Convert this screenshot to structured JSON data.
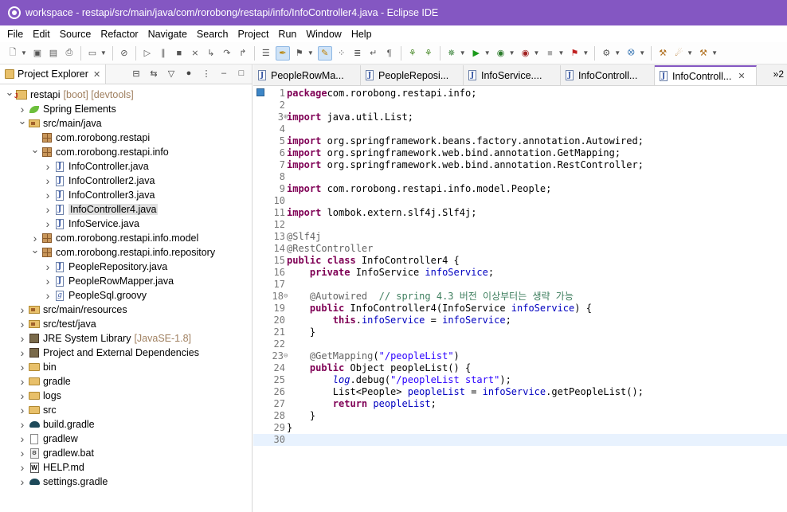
{
  "window": {
    "title": "workspace - restapi/src/main/java/com/rorobong/restapi/info/InfoController4.java - Eclipse IDE"
  },
  "menu": [
    "File",
    "Edit",
    "Source",
    "Refactor",
    "Navigate",
    "Search",
    "Project",
    "Run",
    "Window",
    "Help"
  ],
  "explorer": {
    "tab_label": "Project Explorer",
    "close": "✕",
    "tree": [
      {
        "label": "restapi",
        "extra": "[boot] [devtools]",
        "depth": 0,
        "arrow": "open",
        "icon": "project-icon"
      },
      {
        "label": "Spring Elements",
        "extra": "",
        "depth": 1,
        "arrow": "closed",
        "icon": "spring-leaf-icon"
      },
      {
        "label": "src/main/java",
        "extra": "",
        "depth": 1,
        "arrow": "open",
        "icon": "source-folder-icon"
      },
      {
        "label": "com.rorobong.restapi",
        "extra": "",
        "depth": 2,
        "arrow": "none",
        "icon": "package-icon"
      },
      {
        "label": "com.rorobong.restapi.info",
        "extra": "",
        "depth": 2,
        "arrow": "open",
        "icon": "package-icon"
      },
      {
        "label": "InfoController.java",
        "extra": "",
        "depth": 3,
        "arrow": "closed",
        "icon": "java-file-icon"
      },
      {
        "label": "InfoController2.java",
        "extra": "",
        "depth": 3,
        "arrow": "closed",
        "icon": "java-file-icon"
      },
      {
        "label": "InfoController3.java",
        "extra": "",
        "depth": 3,
        "arrow": "closed",
        "icon": "java-file-icon"
      },
      {
        "label": "InfoController4.java",
        "extra": "",
        "depth": 3,
        "arrow": "closed",
        "icon": "java-file-icon",
        "selected": true
      },
      {
        "label": "InfoService.java",
        "extra": "",
        "depth": 3,
        "arrow": "closed",
        "icon": "java-file-icon"
      },
      {
        "label": "com.rorobong.restapi.info.model",
        "extra": "",
        "depth": 2,
        "arrow": "closed",
        "icon": "package-icon"
      },
      {
        "label": "com.rorobong.restapi.info.repository",
        "extra": "",
        "depth": 2,
        "arrow": "open",
        "icon": "package-icon"
      },
      {
        "label": "PeopleRepository.java",
        "extra": "",
        "depth": 3,
        "arrow": "closed",
        "icon": "java-file-icon"
      },
      {
        "label": "PeopleRowMapper.java",
        "extra": "",
        "depth": 3,
        "arrow": "closed",
        "icon": "java-file-icon"
      },
      {
        "label": "PeopleSql.groovy",
        "extra": "",
        "depth": 3,
        "arrow": "closed",
        "icon": "groovy-file-icon"
      },
      {
        "label": "src/main/resources",
        "extra": "",
        "depth": 1,
        "arrow": "closed",
        "icon": "source-folder-icon"
      },
      {
        "label": "src/test/java",
        "extra": "",
        "depth": 1,
        "arrow": "closed",
        "icon": "source-folder-icon"
      },
      {
        "label": "JRE System Library",
        "extra": "[JavaSE-1.8]",
        "depth": 1,
        "arrow": "closed",
        "icon": "library-icon"
      },
      {
        "label": "Project and External Dependencies",
        "extra": "",
        "depth": 1,
        "arrow": "closed",
        "icon": "library-icon"
      },
      {
        "label": "bin",
        "extra": "",
        "depth": 1,
        "arrow": "closed",
        "icon": "folder-icon"
      },
      {
        "label": "gradle",
        "extra": "",
        "depth": 1,
        "arrow": "closed",
        "icon": "folder-icon"
      },
      {
        "label": "logs",
        "extra": "",
        "depth": 1,
        "arrow": "closed",
        "icon": "folder-icon"
      },
      {
        "label": "src",
        "extra": "",
        "depth": 1,
        "arrow": "closed",
        "icon": "folder-icon"
      },
      {
        "label": "build.gradle",
        "extra": "",
        "depth": 1,
        "arrow": "closed",
        "icon": "gradle-icon"
      },
      {
        "label": "gradlew",
        "extra": "",
        "depth": 1,
        "arrow": "closed",
        "icon": "file-icon"
      },
      {
        "label": "gradlew.bat",
        "extra": "",
        "depth": 1,
        "arrow": "closed",
        "icon": "bat-file-icon"
      },
      {
        "label": "HELP.md",
        "extra": "",
        "depth": 1,
        "arrow": "closed",
        "icon": "markdown-file-icon"
      },
      {
        "label": "settings.gradle",
        "extra": "",
        "depth": 1,
        "arrow": "closed",
        "icon": "gradle-icon"
      }
    ]
  },
  "editor": {
    "tabs": [
      {
        "label": "PeopleRowMa...",
        "active": false
      },
      {
        "label": "PeopleReposi...",
        "active": false
      },
      {
        "label": "InfoService....",
        "active": false
      },
      {
        "label": "InfoControll...",
        "active": false
      },
      {
        "label": "InfoControll...",
        "active": true
      }
    ],
    "overflow": "»2",
    "current_line": 30,
    "lines": [
      {
        "n": "1",
        "fold": "",
        "segs": [
          [
            "kw",
            "package"
          ],
          [
            "",
            "com.rorobong.restapi.info;"
          ]
        ]
      },
      {
        "n": "2",
        "fold": "",
        "segs": []
      },
      {
        "n": "3",
        "fold": "⊕",
        "segs": [
          [
            "kw",
            "import"
          ],
          [
            "",
            " java.util.List;"
          ]
        ]
      },
      {
        "n": "4",
        "fold": "",
        "segs": []
      },
      {
        "n": "5",
        "fold": "",
        "segs": [
          [
            "kw",
            "import"
          ],
          [
            "",
            " org.springframework.beans.factory.annotation.Autowired;"
          ]
        ]
      },
      {
        "n": "6",
        "fold": "",
        "segs": [
          [
            "kw",
            "import"
          ],
          [
            "",
            " org.springframework.web.bind.annotation.GetMapping;"
          ]
        ]
      },
      {
        "n": "7",
        "fold": "",
        "segs": [
          [
            "kw",
            "import"
          ],
          [
            "",
            " org.springframework.web.bind.annotation.RestController;"
          ]
        ]
      },
      {
        "n": "8",
        "fold": "",
        "segs": []
      },
      {
        "n": "9",
        "fold": "",
        "segs": [
          [
            "kw",
            "import"
          ],
          [
            "",
            " com.rorobong.restapi.info.model.People;"
          ]
        ]
      },
      {
        "n": "10",
        "fold": "",
        "segs": []
      },
      {
        "n": "11",
        "fold": "",
        "segs": [
          [
            "kw",
            "import"
          ],
          [
            "",
            " lombok.extern.slf4j.Slf4j;"
          ]
        ]
      },
      {
        "n": "12",
        "fold": "",
        "segs": []
      },
      {
        "n": "13",
        "fold": "",
        "segs": [
          [
            "ann",
            "@Slf4j"
          ]
        ]
      },
      {
        "n": "14",
        "fold": "",
        "segs": [
          [
            "ann",
            "@RestController"
          ]
        ]
      },
      {
        "n": "15",
        "fold": "",
        "segs": [
          [
            "kw",
            "public class"
          ],
          [
            "",
            " InfoController4 {"
          ]
        ]
      },
      {
        "n": "16",
        "fold": "",
        "segs": [
          [
            "",
            "    "
          ],
          [
            "kw",
            "private"
          ],
          [
            "",
            " InfoService "
          ],
          [
            "fld",
            "infoService"
          ],
          [
            "",
            ";"
          ]
        ]
      },
      {
        "n": "17",
        "fold": "",
        "segs": []
      },
      {
        "n": "18",
        "fold": "⊖",
        "segs": [
          [
            "",
            "    "
          ],
          [
            "ann",
            "@Autowired"
          ],
          [
            "",
            "  "
          ],
          [
            "cmt",
            "// spring 4.3 버전 이상부터는 생략 가능"
          ]
        ]
      },
      {
        "n": "19",
        "fold": "",
        "segs": [
          [
            "",
            "    "
          ],
          [
            "kw",
            "public"
          ],
          [
            "",
            " InfoController4(InfoService "
          ],
          [
            "fld",
            "infoService"
          ],
          [
            "",
            ") {"
          ]
        ]
      },
      {
        "n": "20",
        "fold": "",
        "segs": [
          [
            "",
            "        "
          ],
          [
            "kw",
            "this"
          ],
          [
            "",
            "."
          ],
          [
            "fld",
            "infoService"
          ],
          [
            "",
            " = "
          ],
          [
            "fld",
            "infoService"
          ],
          [
            "",
            ";"
          ]
        ]
      },
      {
        "n": "21",
        "fold": "",
        "segs": [
          [
            "",
            "    }"
          ]
        ]
      },
      {
        "n": "22",
        "fold": "",
        "segs": []
      },
      {
        "n": "23",
        "fold": "⊖",
        "segs": [
          [
            "",
            "    "
          ],
          [
            "ann",
            "@GetMapping"
          ],
          [
            "",
            "("
          ],
          [
            "str",
            "\"/peopleList\""
          ],
          [
            "",
            ")"
          ]
        ]
      },
      {
        "n": "24",
        "fold": "",
        "segs": [
          [
            "",
            "    "
          ],
          [
            "kw",
            "public"
          ],
          [
            "",
            " Object peopleList() {"
          ]
        ]
      },
      {
        "n": "25",
        "fold": "",
        "segs": [
          [
            "",
            "        "
          ],
          [
            "fldit",
            "log"
          ],
          [
            "",
            ".debug("
          ],
          [
            "str",
            "\"/peopleList start\""
          ],
          [
            "",
            ");"
          ]
        ]
      },
      {
        "n": "26",
        "fold": "",
        "segs": [
          [
            "",
            "        List<People> "
          ],
          [
            "fld",
            "peopleList"
          ],
          [
            "",
            " = "
          ],
          [
            "fld",
            "infoService"
          ],
          [
            "",
            ".getPeopleList();"
          ]
        ]
      },
      {
        "n": "27",
        "fold": "",
        "segs": [
          [
            "",
            "        "
          ],
          [
            "kw",
            "return"
          ],
          [
            "",
            " "
          ],
          [
            "fld",
            "peopleList"
          ],
          [
            "",
            ";"
          ]
        ]
      },
      {
        "n": "28",
        "fold": "",
        "segs": [
          [
            "",
            "    }"
          ]
        ]
      },
      {
        "n": "29",
        "fold": "",
        "segs": [
          [
            "",
            "}"
          ]
        ]
      },
      {
        "n": "30",
        "fold": "",
        "segs": []
      }
    ]
  },
  "colors": {
    "titlebar": "#8457c2",
    "keyword": "#7f0055",
    "string": "#2a00ff",
    "comment": "#3f7f5f",
    "field": "#0000c0",
    "annotation": "#646464"
  }
}
